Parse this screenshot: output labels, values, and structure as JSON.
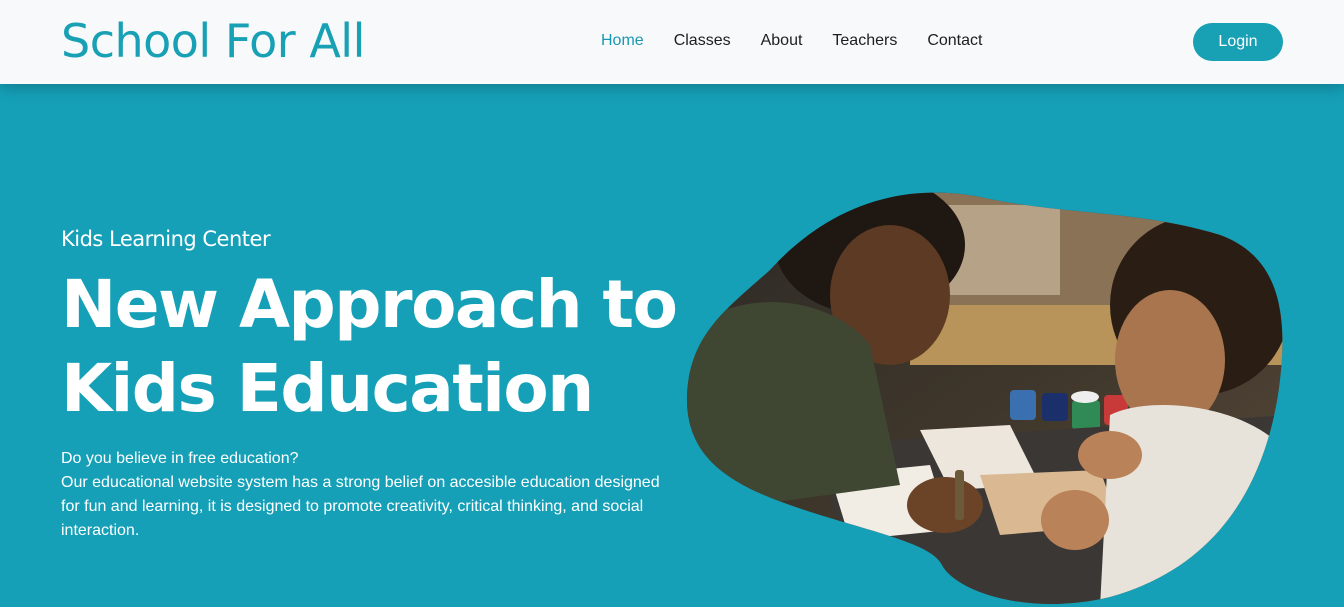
{
  "header": {
    "logo": "School For All",
    "nav": [
      {
        "label": "Home",
        "active": true
      },
      {
        "label": "Classes",
        "active": false
      },
      {
        "label": "About",
        "active": false
      },
      {
        "label": "Teachers",
        "active": false
      },
      {
        "label": "Contact",
        "active": false
      }
    ],
    "login_label": "Login"
  },
  "hero": {
    "kicker": "Kids Learning Center",
    "headline_line1": "New Approach to",
    "headline_line2": "Kids Education",
    "paragraph_line1": "Do you believe in free education?",
    "paragraph_line2": "Our educational website system has a strong belief on accesible education designed for fun and learning, it is designed to promote creativity, critical thinking, and social interaction.",
    "image_icon": "kids-drawing-photo-icon"
  },
  "colors": {
    "brand": "#18a0b5",
    "hero_bg": "#15a0b8",
    "header_bg": "#f8f9fa",
    "nav_text": "#1e1e1e",
    "nav_active": "#1999b0",
    "white": "#ffffff"
  }
}
